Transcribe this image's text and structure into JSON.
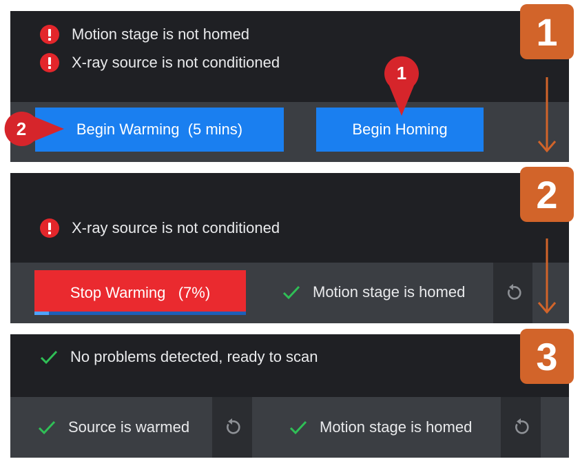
{
  "colors": {
    "panel_top": "#1f2024",
    "panel_bottom": "#3b3e43",
    "button_blue": "#1a7ff0",
    "button_red": "#ea2a2f",
    "error_red": "#e3262b",
    "check_green": "#2fbf56",
    "step_badge": "#d2642a",
    "callout_red": "#d6252b"
  },
  "step1": {
    "badge": "1",
    "messages": [
      {
        "icon": "error-icon",
        "text": "Motion stage is not homed"
      },
      {
        "icon": "error-icon",
        "text": "X-ray source is not conditioned"
      }
    ],
    "warming_button": "Begin Warming  (5 mins)",
    "homing_button": "Begin Homing",
    "callouts": [
      {
        "number": "1",
        "points_to": "homing_button"
      },
      {
        "number": "2",
        "points_to": "warming_button"
      }
    ]
  },
  "step2": {
    "badge": "2",
    "messages": [
      {
        "icon": "error-icon",
        "text": "X-ray source is not conditioned"
      }
    ],
    "stop_button": "Stop Warming   (7%)",
    "warming_progress": 0.07,
    "homed_status": "Motion stage is homed",
    "reset_icon": "reset-icon"
  },
  "step3": {
    "badge": "3",
    "message": "No problems detected, ready to scan",
    "source_status": "Source is warmed",
    "homed_status": "Motion stage is homed",
    "reset_icon": "reset-icon"
  }
}
